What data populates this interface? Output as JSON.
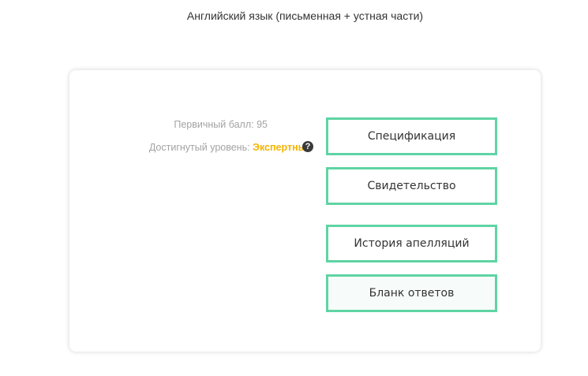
{
  "header": {
    "subject_title": "Английский язык (письменная + устная части)"
  },
  "result": {
    "score_label": "Первичный балл: 95",
    "level_label": "Достигнутый уровень: ",
    "level_value": "Экспертный",
    "help_icon": "question-circle-icon",
    "level_color": "#f5b400"
  },
  "actions": {
    "specification": "Спецификация",
    "certificate": "Свидетельство",
    "appeals_history": "История апелляций",
    "answer_sheet": "Бланк ответов",
    "border_color": "#5fd4a4"
  }
}
